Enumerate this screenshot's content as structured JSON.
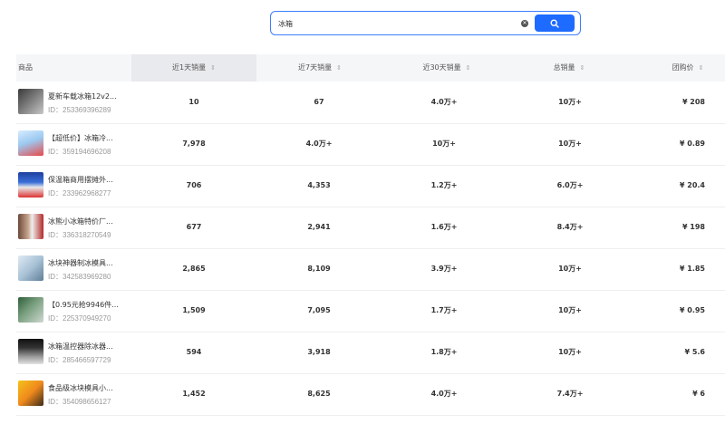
{
  "search": {
    "value": "冰箱"
  },
  "table": {
    "headers": {
      "product": "商品",
      "sales_1d": "近1天销量",
      "sales_7d": "近7天销量",
      "sales_30d": "近30天销量",
      "total": "总销量",
      "price": "团购价"
    },
    "rows": [
      {
        "name": "夏新车载冰箱12v2...",
        "id": "ID：253369396289",
        "d1": "10",
        "d7": "67",
        "d30": "4.0万+",
        "total": "10万+",
        "price": "¥ 208"
      },
      {
        "name": "【超低价】冰箱冷...",
        "id": "ID：359194696208",
        "d1": "7,978",
        "d7": "4.0万+",
        "d30": "10万+",
        "total": "10万+",
        "price": "¥ 0.89"
      },
      {
        "name": "保温箱商用摆摊外...",
        "id": "ID：233962968277",
        "d1": "706",
        "d7": "4,353",
        "d30": "1.2万+",
        "total": "6.0万+",
        "price": "¥ 20.4"
      },
      {
        "name": "冰熊小冰箱特价厂...",
        "id": "ID：336318270549",
        "d1": "677",
        "d7": "2,941",
        "d30": "1.6万+",
        "total": "8.4万+",
        "price": "¥ 198"
      },
      {
        "name": "冰块神器制冰模具...",
        "id": "ID：342583969280",
        "d1": "2,865",
        "d7": "8,109",
        "d30": "3.9万+",
        "total": "10万+",
        "price": "¥ 1.85"
      },
      {
        "name": "【0.95元抢9946件...",
        "id": "ID：225370949270",
        "d1": "1,509",
        "d7": "7,095",
        "d30": "1.7万+",
        "total": "10万+",
        "price": "¥ 0.95"
      },
      {
        "name": "冰箱温控器除冰器...",
        "id": "ID：285466597729",
        "d1": "594",
        "d7": "3,918",
        "d30": "1.8万+",
        "total": "10万+",
        "price": "¥ 5.6"
      },
      {
        "name": "食品级冰块模具小...",
        "id": "ID：354098656127",
        "d1": "1,452",
        "d7": "8,625",
        "d30": "4.0万+",
        "total": "7.4万+",
        "price": "¥ 6"
      }
    ]
  },
  "colors": {
    "accent": "#1e6bff",
    "header_bg": "#f5f6f8",
    "active_header_bg": "#e9eaed"
  },
  "icons": {
    "search": "search-icon",
    "clear": "clear-icon",
    "sort": "sort-icon"
  }
}
